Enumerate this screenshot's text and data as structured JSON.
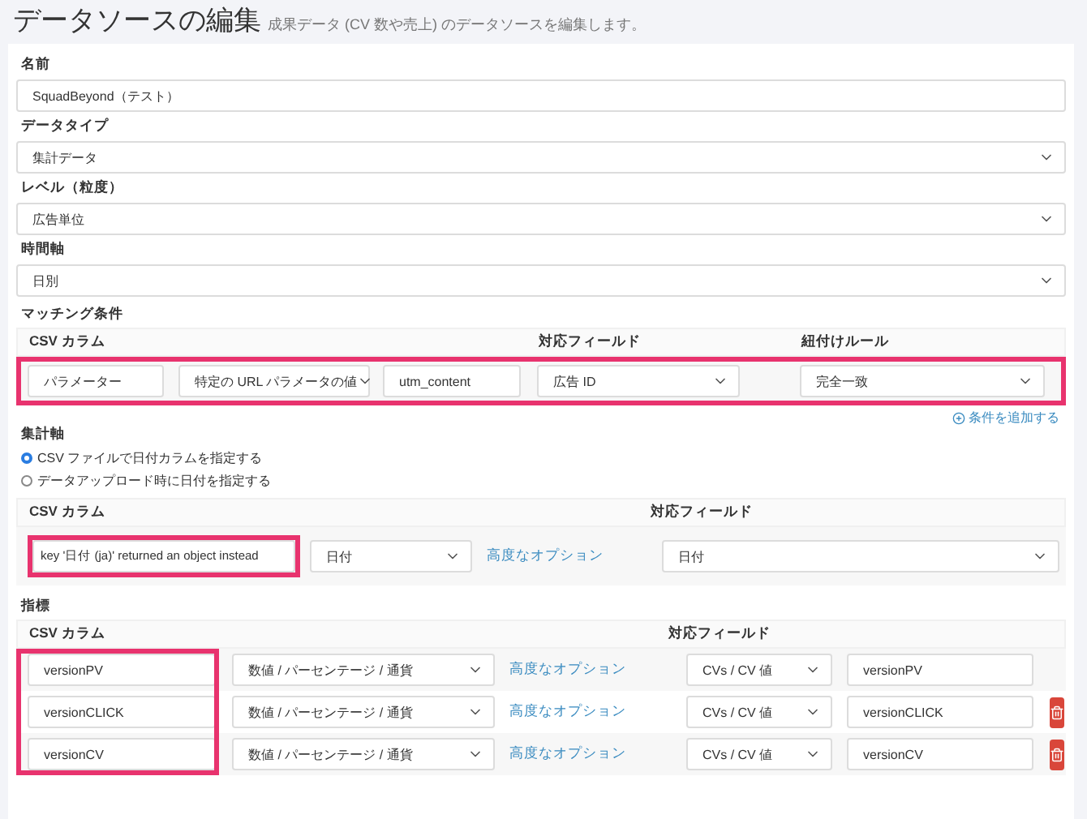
{
  "header": {
    "title": "データソースの編集",
    "subtitle": "成果データ (CV 数や売上) のデータソースを編集します。"
  },
  "fields": [
    {
      "label": "名前",
      "kind": "input",
      "value": "SquadBeyond（テスト）"
    },
    {
      "label": "データタイプ",
      "kind": "select",
      "value": "集計データ"
    },
    {
      "label": "レベル（粒度）",
      "kind": "select",
      "value": "広告単位"
    },
    {
      "label": "時間軸",
      "kind": "select",
      "value": "日別"
    }
  ],
  "matching": {
    "title": "マッチング条件",
    "columns": [
      "CSV カラム",
      "対応フィールド",
      "紐付けルール"
    ],
    "highlighted": true,
    "cells": [
      {
        "kind": "input",
        "value": "パラメーター"
      },
      {
        "kind": "select",
        "value": "特定の URL パラメータの値"
      },
      {
        "kind": "input",
        "value": "utm_content"
      },
      {
        "kind": "select",
        "value": "広告 ID"
      },
      {
        "kind": "select",
        "value": "完全一致"
      }
    ],
    "add_link": "条件を追加する"
  },
  "aggregation": {
    "title": "集計軸",
    "options": [
      {
        "label": "CSV ファイルで日付カラムを指定する",
        "selected": true
      },
      {
        "label": "データアップロード時に日付を指定する",
        "selected": false
      }
    ],
    "columns": [
      "CSV カラム",
      "対応フィールド"
    ],
    "row": {
      "csv": "key '日付 (ja)' returned an object instead",
      "highlighted": true,
      "type": "日付",
      "link": "高度なオプション",
      "field": "日付"
    }
  },
  "metrics": {
    "title": "指標",
    "columns": [
      "CSV カラム",
      "対応フィールド"
    ],
    "highlighted": true,
    "rows": [
      {
        "csv": "versionPV",
        "type": "数値 / パーセンテージ / 通貨",
        "link": "高度なオプション",
        "field": "CVs / CV 値",
        "name": "versionPV",
        "deletable": false
      },
      {
        "csv": "versionCLICK",
        "type": "数値 / パーセンテージ / 通貨",
        "link": "高度なオプション",
        "field": "CVs / CV 値",
        "name": "versionCLICK",
        "deletable": true
      },
      {
        "csv": "versionCV",
        "type": "数値 / パーセンテージ / 通貨",
        "link": "高度なオプション",
        "field": "CVs / CV 値",
        "name": "versionCV",
        "deletable": true
      }
    ]
  }
}
